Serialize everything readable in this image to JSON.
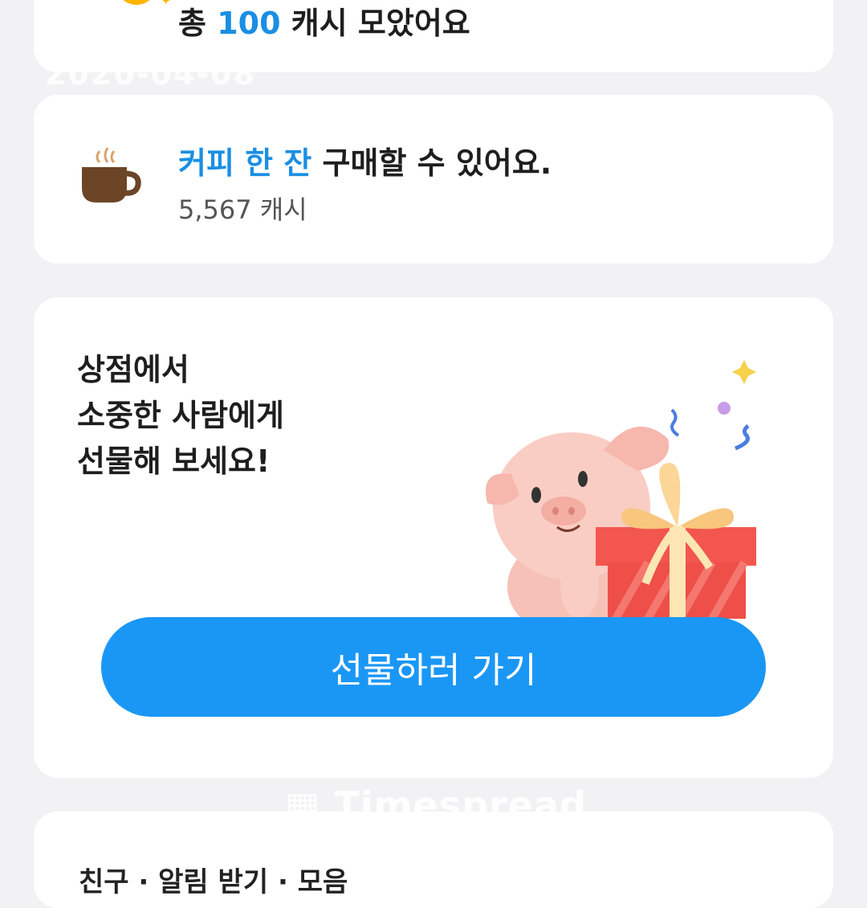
{
  "summary_card": {
    "prefix": "총",
    "amount": "100",
    "suffix": "캐시 모았어요"
  },
  "date_watermark": "2020-04-08",
  "coffee_card": {
    "highlight": "커피 한 잔",
    "rest": "구매할 수 있어요.",
    "cash_amount": "5,567 캐시",
    "icon": "coffee-cup-icon"
  },
  "gift_card": {
    "lines": [
      "상점에서",
      "소중한 사람에게",
      "선물해 보세요!"
    ],
    "button_label": "선물하러 가기",
    "illustration": "pig-with-gift-illustration"
  },
  "brand_watermark": "Timespread",
  "next_card": {
    "partial_text": "친구 · 알림 받기 · 모음"
  },
  "colors": {
    "accent": "#1a8fe3",
    "button": "#1a97f5",
    "background": "#f2f2f4",
    "card": "#ffffff"
  }
}
